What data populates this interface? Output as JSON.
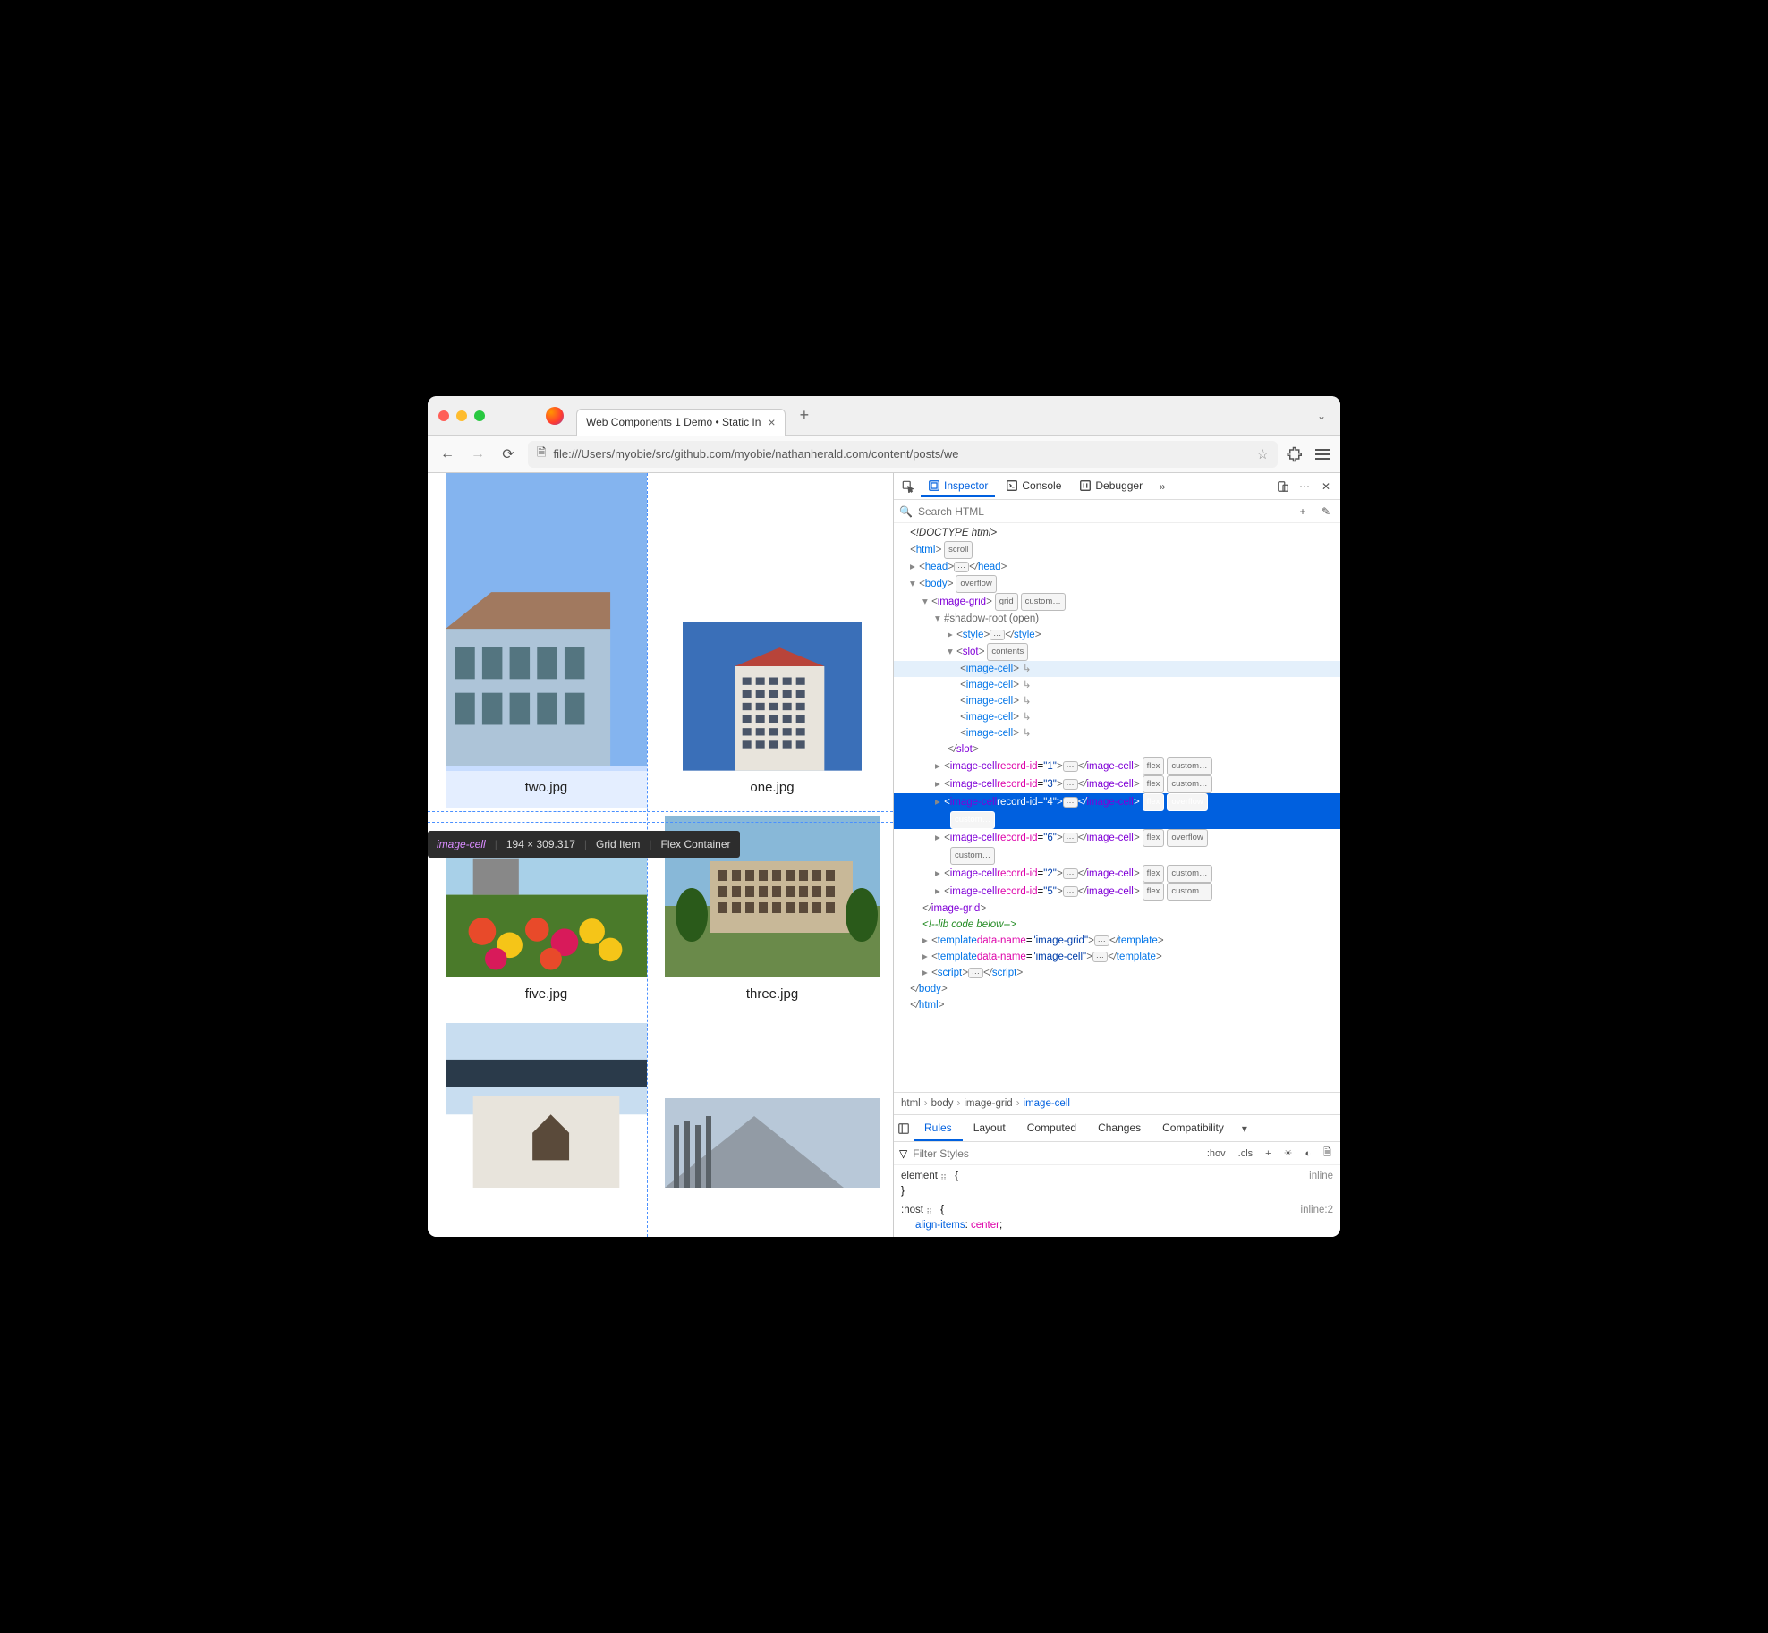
{
  "window": {
    "tab_title": "Web Components 1 Demo • Static In",
    "url": "file:///Users/myobie/src/github.com/myobie/nathanherald.com/content/posts/we"
  },
  "devtools": {
    "tabs": {
      "inspector": "Inspector",
      "console": "Console",
      "debugger": "Debugger"
    },
    "search_placeholder": "Search HTML",
    "breadcrumb": [
      "html",
      "body",
      "image-grid",
      "image-cell"
    ],
    "rules_tabs": [
      "Rules",
      "Layout",
      "Computed",
      "Changes",
      "Compatibility"
    ],
    "filter_placeholder": "Filter Styles",
    "filter_buttons": {
      "hov": ":hov",
      "cls": ".cls"
    },
    "rules": {
      "element_src": "inline",
      "element_sel": "element",
      "host_sel": ":host",
      "host_src": "inline:2",
      "host_props": [
        {
          "name": "align-items",
          "value": "center"
        }
      ]
    }
  },
  "tooltip": {
    "element": "image-cell",
    "dims": "194 × 309.317",
    "grid": "Grid Item",
    "flex": "Flex Container"
  },
  "content": {
    "cells": [
      {
        "caption": "two.jpg",
        "highlighted": true
      },
      {
        "caption": "one.jpg"
      },
      {
        "caption": "five.jpg"
      },
      {
        "caption": "three.jpg"
      },
      {
        "caption": ""
      },
      {
        "caption": ""
      }
    ]
  },
  "dom": {
    "doctype": "<!DOCTYPE html>",
    "body_badge": "overflow",
    "grid_badges": [
      "grid",
      "custom…"
    ],
    "slot_badge": "contents",
    "shadow": "#shadow-root (open)",
    "image_cells_slot": 5,
    "cells": [
      {
        "id": "1",
        "badges": [
          "flex",
          "custom…"
        ]
      },
      {
        "id": "3",
        "badges": [
          "flex",
          "custom…"
        ]
      },
      {
        "id": "4",
        "badges": [
          "flex",
          "overflow",
          "custom…"
        ],
        "selected": true
      },
      {
        "id": "6",
        "badges": [
          "flex",
          "overflow",
          "custom…"
        ]
      },
      {
        "id": "2",
        "badges": [
          "flex",
          "custom…"
        ]
      },
      {
        "id": "5",
        "badges": [
          "flex",
          "custom…"
        ]
      }
    ],
    "comment": "<!--lib code below-->",
    "templates": [
      "image-grid",
      "image-cell"
    ]
  }
}
